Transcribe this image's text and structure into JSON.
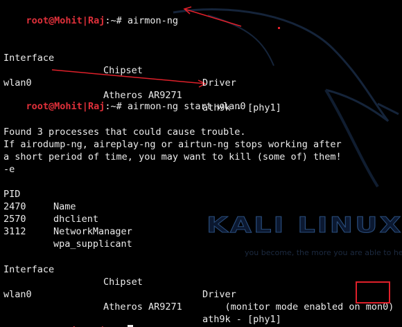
{
  "prompt": {
    "user": "root@Mohit",
    "separator": "|",
    "host": "Raj",
    "path": ":~# "
  },
  "commands": {
    "first": "airmon-ng",
    "second": "airmon-ng start wlan0"
  },
  "table_headers": {
    "interface": "Interface",
    "chipset": "Chipset",
    "driver": "Driver"
  },
  "first_output": {
    "interface": "wlan0",
    "chipset": "Atheros AR9271",
    "driver": "ath9k - [phy1]"
  },
  "warning": {
    "line1": "Found 3 processes that could cause trouble.",
    "line2": "If airodump-ng, aireplay-ng or airtun-ng stops working after",
    "line3": "a short period of time, you may want to kill (some of) them!",
    "line4": "-e"
  },
  "process_headers": {
    "pid": "PID",
    "name": "Name"
  },
  "processes": [
    {
      "pid": "2470",
      "name": "dhclient"
    },
    {
      "pid": "2570",
      "name": "NetworkManager"
    },
    {
      "pid": "3112",
      "name": "wpa_supplicant"
    }
  ],
  "second_output": {
    "interface": "wlan0",
    "chipset": "Atheros AR9271",
    "driver": "ath9k - [phy1]",
    "monitor_prefix": "(monitor mode enabled on ",
    "monitor_iface": "mon0",
    "monitor_suffix": ")"
  },
  "watermark": {
    "logo": "KALI LINUX",
    "tagline": "you become, the more you are able to hear"
  },
  "colors": {
    "background": "#000000",
    "text": "#ececec",
    "prompt": "#e0303a",
    "annotation": "#e0202a"
  }
}
